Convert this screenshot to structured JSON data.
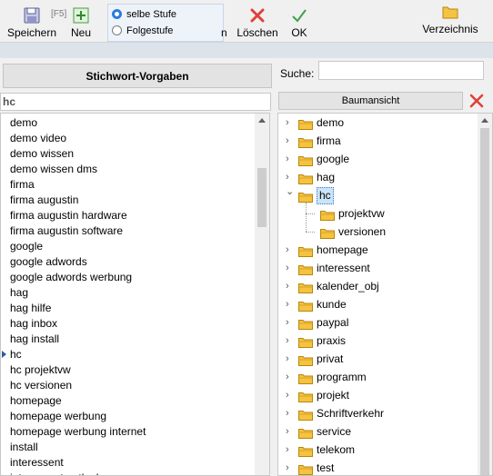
{
  "toolbar": {
    "save_label": "Speichern",
    "new_shortcut": "[F5]",
    "new_label": "Neu",
    "radio_same_level": "selbe Stufe",
    "radio_next_level": "Folgestufe",
    "hidden_label_tail": "n",
    "delete_label": "Löschen",
    "ok_label": "OK",
    "directory_label": "Verzeichnis"
  },
  "left": {
    "keyword_button": "Stichwort-Vorgaben",
    "filter_value": "hc",
    "items": [
      "demo",
      "demo video",
      "demo wissen",
      "demo wissen dms",
      "firma",
      "firma augustin",
      "firma augustin hardware",
      "firma augustin software",
      "google",
      "google adwords",
      "google adwords werbung",
      "hag",
      "hag hilfe",
      "hag inbox",
      "hag install",
      "hc",
      "hc projektvw",
      "hc versionen",
      "homepage",
      "homepage werbung",
      "homepage werbung internet",
      "install",
      "interessent",
      "interessent outlook"
    ],
    "selected_index": 15
  },
  "right": {
    "search_label": "Suche:",
    "search_value": "",
    "tree_button": "Baumansicht",
    "tree": [
      {
        "label": "demo",
        "level": 0,
        "expanded": false
      },
      {
        "label": "firma",
        "level": 0,
        "expanded": false
      },
      {
        "label": "google",
        "level": 0,
        "expanded": false
      },
      {
        "label": "hag",
        "level": 0,
        "expanded": false
      },
      {
        "label": "hc",
        "level": 0,
        "expanded": true,
        "selected": true
      },
      {
        "label": "projektvw",
        "level": 1,
        "expanded": false
      },
      {
        "label": "versionen",
        "level": 1,
        "expanded": false
      },
      {
        "label": "homepage",
        "level": 0,
        "expanded": false
      },
      {
        "label": "interessent",
        "level": 0,
        "expanded": false
      },
      {
        "label": "kalender_obj",
        "level": 0,
        "expanded": false
      },
      {
        "label": "kunde",
        "level": 0,
        "expanded": false
      },
      {
        "label": "paypal",
        "level": 0,
        "expanded": false
      },
      {
        "label": "praxis",
        "level": 0,
        "expanded": false
      },
      {
        "label": "privat",
        "level": 0,
        "expanded": false
      },
      {
        "label": "programm",
        "level": 0,
        "expanded": false
      },
      {
        "label": "projekt",
        "level": 0,
        "expanded": false
      },
      {
        "label": "Schriftverkehr",
        "level": 0,
        "expanded": false
      },
      {
        "label": "service",
        "level": 0,
        "expanded": false
      },
      {
        "label": "telekom",
        "level": 0,
        "expanded": false
      },
      {
        "label": "test",
        "level": 0,
        "expanded": false
      }
    ]
  },
  "colors": {
    "accent": "#2b7bd6",
    "delete_red": "#e0403a",
    "ok_green": "#3aa34a",
    "folder_yellow": "#f5c342"
  }
}
